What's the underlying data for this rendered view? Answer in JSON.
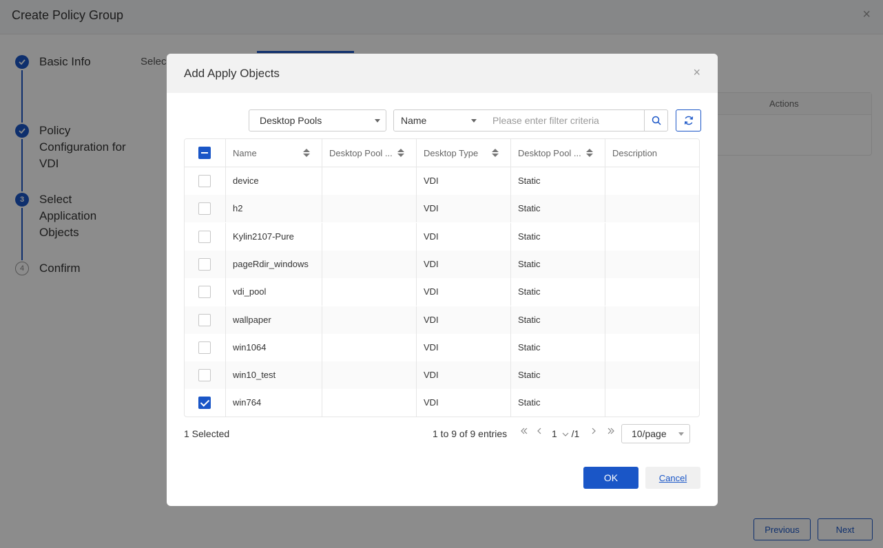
{
  "page": {
    "title": "Create Policy Group",
    "close_icon": "×",
    "select_label": "Selec",
    "actions_header": "Actions",
    "previous_label": "Previous",
    "next_label": "Next"
  },
  "steps": [
    {
      "label": "Basic Info",
      "state": "done",
      "marker": ""
    },
    {
      "label": "Policy Configuration for VDI",
      "state": "done",
      "marker": ""
    },
    {
      "label": "Select Application Objects",
      "state": "active",
      "marker": "3"
    },
    {
      "label": "Confirm",
      "state": "pending",
      "marker": "4"
    }
  ],
  "modal": {
    "title": "Add Apply Objects",
    "close_icon": "×",
    "filter_type": "Desktop Pools",
    "filter_field": "Name",
    "filter_placeholder": "Please enter filter criteria",
    "columns": [
      "Name",
      "Desktop Pool ...",
      "Desktop Type",
      "Desktop Pool ...",
      "Description"
    ],
    "rows": [
      {
        "name": "device",
        "pool": "",
        "type": "VDI",
        "pool_kind": "Static",
        "description": "",
        "checked": false
      },
      {
        "name": "h2",
        "pool": "",
        "type": "VDI",
        "pool_kind": "Static",
        "description": "",
        "checked": false
      },
      {
        "name": "Kylin2107-Pure",
        "pool": "",
        "type": "VDI",
        "pool_kind": "Static",
        "description": "",
        "checked": false
      },
      {
        "name": "pageRdir_windows",
        "pool": "",
        "type": "VDI",
        "pool_kind": "Static",
        "description": "",
        "checked": false
      },
      {
        "name": "vdi_pool",
        "pool": "",
        "type": "VDI",
        "pool_kind": "Static",
        "description": "",
        "checked": false
      },
      {
        "name": "wallpaper",
        "pool": "",
        "type": "VDI",
        "pool_kind": "Static",
        "description": "",
        "checked": false
      },
      {
        "name": "win1064",
        "pool": "",
        "type": "VDI",
        "pool_kind": "Static",
        "description": "",
        "checked": false
      },
      {
        "name": "win10_test",
        "pool": "",
        "type": "VDI",
        "pool_kind": "Static",
        "description": "",
        "checked": false
      },
      {
        "name": "win764",
        "pool": "",
        "type": "VDI",
        "pool_kind": "Static",
        "description": "",
        "checked": true
      }
    ],
    "selected_text": "1 Selected",
    "entries_text": "1 to 9 of 9 entries",
    "page_current": "1",
    "page_total": "/1",
    "page_size": "10/page",
    "ok_label": "OK",
    "cancel_label": "Cancel"
  },
  "colors": {
    "accent": "#1a56c7",
    "overlay": "rgba(0,0,0,0.45)"
  }
}
